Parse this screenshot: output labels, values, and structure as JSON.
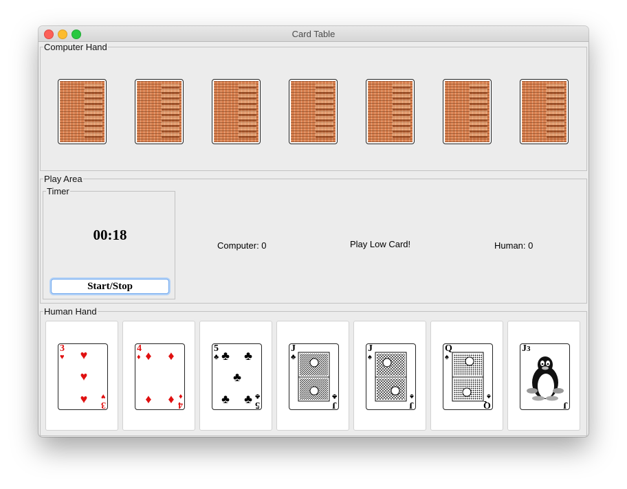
{
  "window": {
    "title": "Card Table"
  },
  "computer_hand": {
    "title": "Computer Hand",
    "card_count": 7
  },
  "play_area": {
    "title": "Play Area",
    "timer": {
      "title": "Timer",
      "value": "00:18",
      "button_label": "Start/Stop"
    },
    "computer_score": "Computer: 0",
    "message": "Play Low Card!",
    "human_score": "Human: 0"
  },
  "human_hand": {
    "title": "Human Hand",
    "cards": [
      {
        "rank": "3",
        "suit": "♥",
        "suit_name": "hearts",
        "color": "#e01010"
      },
      {
        "rank": "4",
        "suit": "♦",
        "suit_name": "diamonds",
        "color": "#e01010"
      },
      {
        "rank": "5",
        "suit": "♣",
        "suit_name": "clubs",
        "color": "#000000"
      },
      {
        "rank": "J",
        "suit": "♣",
        "suit_name": "clubs",
        "color": "#000000"
      },
      {
        "rank": "J",
        "suit": "♠",
        "suit_name": "spades",
        "color": "#000000"
      },
      {
        "rank": "Q",
        "suit": "♠",
        "suit_name": "spades",
        "color": "#000000"
      },
      {
        "rank": "J",
        "suit": "3",
        "suit_name": "joker",
        "color": "#000000"
      }
    ]
  },
  "icons": {
    "close": "close-icon",
    "minimize": "minimize-icon",
    "maximize": "maximize-icon"
  }
}
